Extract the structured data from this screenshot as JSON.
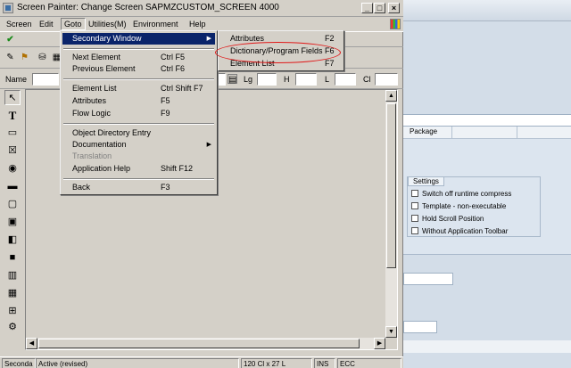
{
  "window": {
    "title": "Screen Painter: Change Screen SAPMZCUSTOM_SCREEN 4000",
    "min": "_",
    "max": "□",
    "close": "×"
  },
  "menubar": [
    "Screen",
    "Edit",
    "Goto",
    "Utilities(M)",
    "Environment",
    "Help"
  ],
  "attrbar": {
    "name_label": "Name",
    "lg": "Lg",
    "h": "H",
    "l": "L",
    "cl": "Cl"
  },
  "goto_menu": {
    "items": [
      {
        "label": "Secondary Window",
        "accel": "",
        "submenu": true
      },
      {
        "label": "Next Element",
        "accel": "Ctrl F5"
      },
      {
        "label": "Previous Element",
        "accel": "Ctrl F6"
      },
      {
        "label": "Element List",
        "accel": "Ctrl Shift F7"
      },
      {
        "label": "Attributes",
        "accel": "F5"
      },
      {
        "label": "Flow Logic",
        "accel": "F9"
      },
      {
        "label": "Object Directory Entry",
        "accel": ""
      },
      {
        "label": "Documentation",
        "accel": "",
        "submenu": true
      },
      {
        "label": "Translation",
        "accel": "",
        "disabled": true
      },
      {
        "label": "Application Help",
        "accel": "Shift F12"
      },
      {
        "label": "Back",
        "accel": "F3"
      }
    ]
  },
  "secondary_menu": {
    "items": [
      {
        "label": "Attributes",
        "accel": "F2"
      },
      {
        "label": "Dictionary/Program Fields",
        "accel": "F6"
      },
      {
        "label": "Element List",
        "accel": "F7"
      }
    ]
  },
  "statusbar": {
    "left": "Seconda",
    "mode": "Active (revised)",
    "size": "120 Cl x 27 L",
    "ins": "INS",
    "ecc": "ECC"
  },
  "background": {
    "package_label": "Package",
    "settings_title": "Settings",
    "settings": [
      "Switch off runtime compress",
      "Template - non-executable",
      "Hold Scroll Position",
      "Without Application Toolbar"
    ]
  },
  "colors": {
    "highlight": "#0a246a",
    "annotation": "#e01818",
    "window": "#d4d0c8"
  }
}
